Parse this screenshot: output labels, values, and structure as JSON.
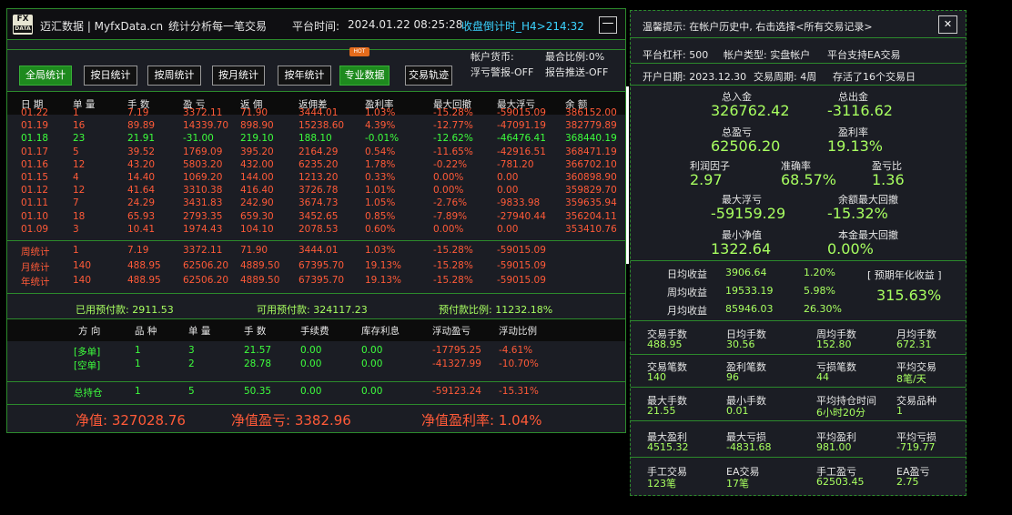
{
  "title": {
    "logo_top": "FX",
    "logo_bottom": "DATA",
    "brand": "迈汇数据 | MyfxData.cn",
    "slogan": "统计分析每一笔交易",
    "time_label": "平台时间:",
    "time_value": "2024.01.22 08:25:28",
    "countdown": "收盘倒计时_H4>214:32",
    "min": "—"
  },
  "buttons": [
    {
      "label": "全局统计",
      "on": true
    },
    {
      "label": "按日统计",
      "on": false
    },
    {
      "label": "按周统计",
      "on": false
    },
    {
      "label": "按月统计",
      "on": false
    },
    {
      "label": "按年统计",
      "on": false
    },
    {
      "label": "专业数据",
      "on": true
    },
    {
      "label": "交易轨迹",
      "on": false
    }
  ],
  "hot": "HOT",
  "info": {
    "currency": "帐户货币:",
    "ratio": "最合比例:0%",
    "float_warn": "浮亏警报-OFF",
    "report": "报告推送-OFF"
  },
  "table": {
    "headers": [
      "日 期",
      "单 量",
      "手 数",
      "盈 亏",
      "返 佣",
      "返佣差",
      "盈利率",
      "最大回撤",
      "最大浮亏",
      "余 额"
    ],
    "rows": [
      {
        "c": "red",
        "v": [
          "01.22",
          "1",
          "7.19",
          "3372.11",
          "71.90",
          "3444.01",
          "1.03%",
          "-15.28%",
          "-59015.09",
          "386152.00"
        ]
      },
      {
        "c": "red",
        "v": [
          "01.19",
          "16",
          "89.89",
          "14339.70",
          "898.90",
          "15238.60",
          "4.39%",
          "-12.77%",
          "-47091.19",
          "382779.89"
        ]
      },
      {
        "c": "grn",
        "v": [
          "01.18",
          "23",
          "21.91",
          "-31.00",
          "219.10",
          "188.10",
          "-0.01%",
          "-12.62%",
          "-46476.41",
          "368440.19"
        ]
      },
      {
        "c": "red",
        "v": [
          "01.17",
          "5",
          "39.52",
          "1769.09",
          "395.20",
          "2164.29",
          "0.54%",
          "-11.65%",
          "-42916.51",
          "368471.19"
        ]
      },
      {
        "c": "red",
        "v": [
          "01.16",
          "12",
          "43.20",
          "5803.20",
          "432.00",
          "6235.20",
          "1.78%",
          "-0.22%",
          "-781.20",
          "366702.10"
        ]
      },
      {
        "c": "red",
        "v": [
          "01.15",
          "4",
          "14.40",
          "1069.20",
          "144.00",
          "1213.20",
          "0.33%",
          "0.00%",
          "0.00",
          "360898.90"
        ]
      },
      {
        "c": "red",
        "v": [
          "01.12",
          "12",
          "41.64",
          "3310.38",
          "416.40",
          "3726.78",
          "1.01%",
          "0.00%",
          "0.00",
          "359829.70"
        ]
      },
      {
        "c": "red",
        "v": [
          "01.11",
          "7",
          "24.29",
          "3431.83",
          "242.90",
          "3674.73",
          "1.05%",
          "-2.76%",
          "-9833.98",
          "359635.94"
        ]
      },
      {
        "c": "red",
        "v": [
          "01.10",
          "18",
          "65.93",
          "2793.35",
          "659.30",
          "3452.65",
          "0.85%",
          "-7.89%",
          "-27940.44",
          "356204.11"
        ]
      },
      {
        "c": "red",
        "v": [
          "01.09",
          "3",
          "10.41",
          "1974.43",
          "104.10",
          "2078.53",
          "0.60%",
          "0.00%",
          "0.00",
          "353410.76"
        ]
      }
    ],
    "stats": [
      {
        "v": [
          "周统计",
          "1",
          "7.19",
          "3372.11",
          "71.90",
          "3444.01",
          "1.03%",
          "-15.28%",
          "-59015.09"
        ]
      },
      {
        "v": [
          "月统计",
          "140",
          "488.95",
          "62506.20",
          "4889.50",
          "67395.70",
          "19.13%",
          "-15.28%",
          "-59015.09"
        ]
      },
      {
        "v": [
          "年统计",
          "140",
          "488.95",
          "62506.20",
          "4889.50",
          "67395.70",
          "19.13%",
          "-15.28%",
          "-59015.09"
        ]
      }
    ]
  },
  "margin": {
    "used": "已用预付款: 2911.53",
    "avail": "可用预付款: 324117.23",
    "ratio": "预付款比例: 11232.18%"
  },
  "pos": {
    "headers": [
      "方 向",
      "品 种",
      "单 量",
      "手 数",
      "手续费",
      "库存利息",
      "浮动盈亏",
      "浮动比例"
    ],
    "rows": [
      {
        "v": [
          "[多单]",
          "1",
          "3",
          "21.57",
          "0.00",
          "0.00",
          "-17795.25",
          "-4.61%"
        ]
      },
      {
        "v": [
          "[空单]",
          "1",
          "2",
          "28.78",
          "0.00",
          "0.00",
          "-41327.99",
          "-10.70%"
        ]
      }
    ],
    "total": {
      "v": [
        "总持仓",
        "1",
        "5",
        "50.35",
        "0.00",
        "0.00",
        "-59123.24",
        "-15.31%"
      ]
    }
  },
  "equity": {
    "net": "净值: 327028.76",
    "pl": "净值盈亏: 3382.96",
    "rate": "净值盈利率: 1.04%"
  },
  "right": {
    "tip": "温馨提示: 在帐户历史中, 右击选择<所有交易记录>",
    "close": "✕",
    "lev": "平台杠杆: 500",
    "acct": "帐户类型: 实盘帐户",
    "ea": "平台支持EA交易",
    "open": "开户日期: 2023.12.30",
    "cycle": "交易周期: 4周",
    "days": "存活了16个交易日",
    "dep_l": "总入金",
    "dep_v": "326762.42",
    "wd_l": "总出金",
    "wd_v": "-3116.62",
    "tp_l": "总盈亏",
    "tp_v": "62506.20",
    "pr_l": "盈利率",
    "pr_v": "19.13%",
    "pf_l": "利润因子",
    "pf_v": "2.97",
    "acc_l": "准确率",
    "acc_v": "68.57%",
    "rr_l": "盈亏比",
    "rr_v": "1.36",
    "mf_l": "最大浮亏",
    "mf_v": "-59159.29",
    "md_l": "余额最大回撤",
    "md_v": "-15.32%",
    "mn_l": "最小净值",
    "mn_v": "1322.64",
    "pd_l": "本金最大回撤",
    "pd_v": "0.00%",
    "d_l": "日均收益",
    "d_v": "3906.64",
    "d_p": "1.20%",
    "w_l": "周均收益",
    "w_v": "19533.19",
    "w_p": "5.98%",
    "m_l": "月均收益",
    "m_v": "85946.03",
    "m_p": "26.30%",
    "ann_l": "[ 预期年化收益 ]",
    "ann_v": "315.63%",
    "grid": [
      [
        [
          "交易手数",
          "488.95"
        ],
        [
          "日均手数",
          "30.56"
        ],
        [
          "周均手数",
          "152.80"
        ],
        [
          "月均手数",
          "672.31"
        ]
      ],
      [
        [
          "交易笔数",
          "140"
        ],
        [
          "盈利笔数",
          "96"
        ],
        [
          "亏损笔数",
          "44"
        ],
        [
          "平均交易",
          "8笔/天"
        ]
      ],
      [
        [
          "最大手数",
          "21.55"
        ],
        [
          "最小手数",
          "0.01"
        ],
        [
          "平均持仓时间",
          "6小时20分"
        ],
        [
          "交易品种",
          "1"
        ]
      ],
      [
        [
          "最大盈利",
          "4515.32"
        ],
        [
          "最大亏损",
          "-4831.68"
        ],
        [
          "平均盈利",
          "981.00"
        ],
        [
          "平均亏损",
          "-719.77"
        ]
      ],
      [
        [
          "手工交易",
          "123笔"
        ],
        [
          "EA交易",
          "17笔"
        ],
        [
          "手工盈亏",
          "62503.45"
        ],
        [
          "EA盈亏",
          "2.75"
        ]
      ]
    ]
  },
  "colors": {
    "accent": "#2c8a2c",
    "red": "#ff5a38",
    "green": "#3dff3d",
    "lime": "#a8ff60",
    "yellow": "#f0c800"
  }
}
